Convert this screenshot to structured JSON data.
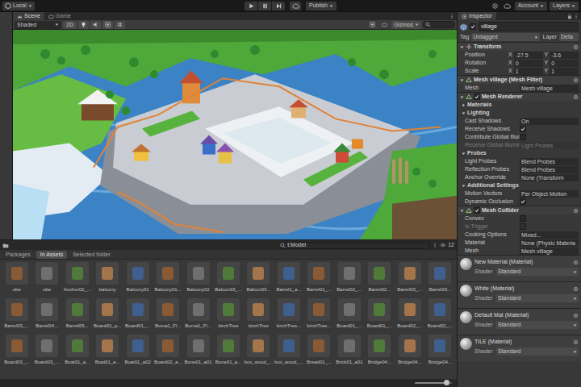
{
  "toolbar": {
    "context": "Local",
    "publish": "Publish",
    "account": "Account",
    "layers": "Layers"
  },
  "scene": {
    "tabs": [
      {
        "label": "Scene",
        "selected": true
      },
      {
        "label": "Game",
        "selected": false
      }
    ],
    "shading": "Shaded",
    "mode_2d": "2D",
    "gizmos": "Gizmos"
  },
  "project": {
    "search": "t:Model",
    "count": "12",
    "tabs": [
      {
        "label": "Packages",
        "selected": false
      },
      {
        "label": "In Assets",
        "selected": true
      },
      {
        "label": "Selected folder",
        "selected": false
      }
    ],
    "zoom": {
      "level": 0.85
    },
    "assets": [
      "obe",
      "obe",
      "Anchor02_...",
      "balcony",
      "Balcony01",
      "Balcony01...",
      "Balcony02",
      "Balcon03_...",
      "Balcon03...",
      "Barrel1_a...",
      "Barrel01_...",
      "Barrel02_...",
      "Barrel02...",
      "Barrel03_...",
      "Barrel03...",
      "Barrel03_...",
      "Barrel04...",
      "Barrel05...",
      "Board01_p...",
      "Board01_...",
      "Boma1_Fl...",
      "Boma1_Fl...",
      "birchTree",
      "birchTree",
      "birchTree...",
      "birchTree...",
      "Board01_...",
      "Board01_...",
      "Board02_...",
      "Board02_...",
      "Board03_...",
      "Board03_...",
      "Boat01_a...",
      "Boat01_a...",
      "Boat01_a02",
      "Board02_a...",
      "Bone01_a01",
      "Bone01_a...",
      "box_wood_...",
      "box_wood_...",
      "Bread01_...",
      "Brick01_a01",
      "Bridge04...",
      "Bridge04...",
      "Bridge04..."
    ]
  },
  "inspector": {
    "tab": "Inspector",
    "rows": [
      {
        "kind": "object",
        "label": "village",
        "checked": true
      },
      {
        "kind": "tag",
        "label": "Tag",
        "value": "Untagged",
        "label2": "Layer",
        "value2": "Defa"
      },
      {
        "kind": "component",
        "label": "Transform",
        "expanded": true
      },
      {
        "kind": "vector",
        "label": "Position",
        "values": [
          {
            "axis": "X",
            "value": "-27.5"
          },
          {
            "axis": "Y",
            "value": "-3.6"
          }
        ]
      },
      {
        "kind": "vector",
        "label": "Rotation",
        "values": [
          {
            "axis": "X",
            "value": "0"
          },
          {
            "axis": "Y",
            "value": "0"
          }
        ]
      },
      {
        "kind": "vector",
        "label": "Scale",
        "values": [
          {
            "axis": "X",
            "value": "1"
          },
          {
            "axis": "Y",
            "value": "1"
          }
        ]
      },
      {
        "kind": "component",
        "label": "Mesh village (Mesh Filter)",
        "expanded": true
      },
      {
        "kind": "field",
        "label": "Mesh",
        "value": "Mesh village",
        "disabled": false
      },
      {
        "kind": "toggle-component",
        "label": "Mesh Renderer",
        "expanded": true,
        "checked": true
      },
      {
        "kind": "section",
        "label": "Materials",
        "expanded": false
      },
      {
        "kind": "section",
        "label": "Lighting",
        "expanded": true
      },
      {
        "kind": "field",
        "label": "Cast Shadows",
        "value": "On",
        "disabled": false
      },
      {
        "kind": "check",
        "label": "Receive Shadows",
        "checked": true,
        "disabled": false
      },
      {
        "kind": "check",
        "label": "Contribute Global Illumi",
        "checked": false,
        "disabled": false
      },
      {
        "kind": "field",
        "label": "Receive Global Illumin",
        "value": "Light Probes",
        "disabled": true
      },
      {
        "kind": "section",
        "label": "Probes",
        "expanded": true
      },
      {
        "kind": "field",
        "label": "Light Probes",
        "value": "Blend Probes",
        "disabled": false
      },
      {
        "kind": "field",
        "label": "Reflection Probes",
        "value": "Blend Probes",
        "disabled": false
      },
      {
        "kind": "field",
        "label": "Anchor Override",
        "value": "None (Transform",
        "disabled": false
      },
      {
        "kind": "section",
        "label": "Additional Settings",
        "expanded": true
      },
      {
        "kind": "field",
        "label": "Motion Vectors",
        "value": "Per Object Motion",
        "disabled": false
      },
      {
        "kind": "check",
        "label": "Dynamic Occlusion",
        "checked": true,
        "disabled": false
      },
      {
        "kind": "toggle-component",
        "label": "Mesh Collider",
        "expanded": true,
        "checked": true
      },
      {
        "kind": "check",
        "label": "Convex",
        "checked": false,
        "disabled": false
      },
      {
        "kind": "check",
        "label": "Is Trigger",
        "checked": false,
        "disabled": true
      },
      {
        "kind": "field",
        "label": "Cooking Options",
        "value": "Mixed...",
        "disabled": false
      },
      {
        "kind": "field",
        "label": "Material",
        "value": "None (Physic Materia",
        "disabled": false
      },
      {
        "kind": "field",
        "label": "Mesh",
        "value": "Mesh village",
        "disabled": false
      },
      {
        "kind": "material",
        "label": "New Material (Material)",
        "shader_label": "Shader",
        "shader": "Standard"
      },
      {
        "kind": "material",
        "label": "White (Material)",
        "shader_label": "Shader",
        "shader": "Standard"
      },
      {
        "kind": "material",
        "label": "Default Mat (Material)",
        "shader_label": "Shader",
        "shader": "Standard"
      },
      {
        "kind": "material",
        "label": "TILE (Material)",
        "shader_label": "Shader",
        "shader": "Standard"
      }
    ]
  }
}
